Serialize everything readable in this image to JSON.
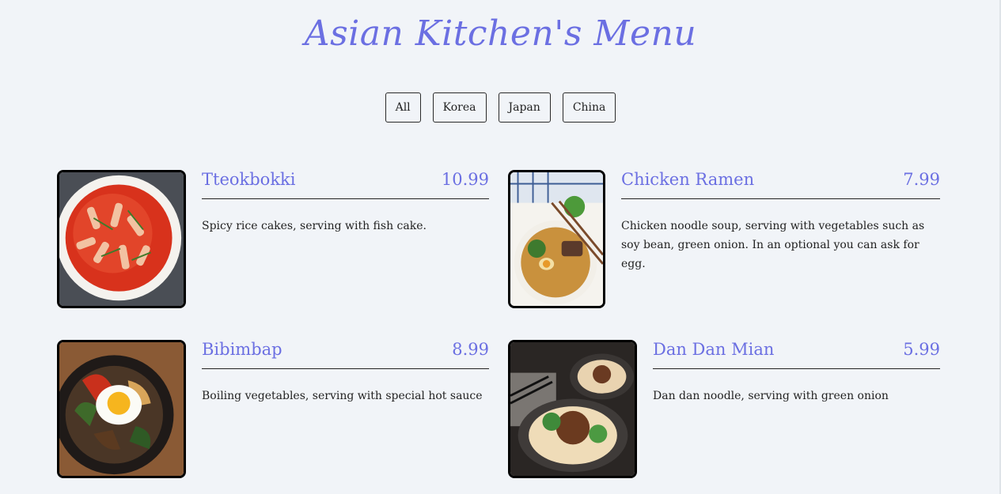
{
  "menu_title": "Asian Kitchen's Menu",
  "filters": [
    "All",
    "Korea",
    "Japan",
    "China"
  ],
  "accent_color": "#6b6fe2",
  "items": [
    {
      "name": "Tteokbokki",
      "price": "10.99",
      "description": "Spicy rice cakes, serving with fish cake.",
      "image": "tteokbokki-photo"
    },
    {
      "name": "Chicken Ramen",
      "price": "7.99",
      "description": "Chicken noodle soup, serving with vegetables such as soy bean, green onion. In an optional you can ask for egg.",
      "image": "chicken-ramen-photo"
    },
    {
      "name": "Bibimbap",
      "price": "8.99",
      "description": "Boiling vegetables, serving with special hot sauce",
      "image": "bibimbap-photo"
    },
    {
      "name": "Dan Dan Mian",
      "price": "5.99",
      "description": "Dan dan noodle, serving with green onion",
      "image": "dan-dan-mian-photo"
    }
  ]
}
